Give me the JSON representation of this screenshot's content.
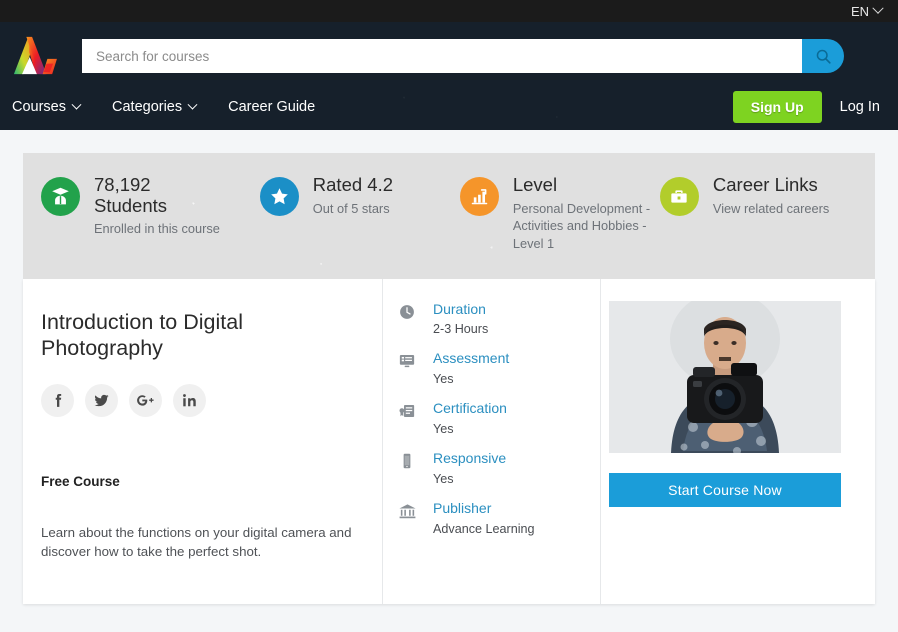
{
  "topbar": {
    "language": "EN",
    "chevron_icon": "chevron-down-icon"
  },
  "header": {
    "logo_icon": "brand-logo-icon",
    "search": {
      "placeholder": "Search for courses",
      "value": "",
      "button_icon": "search-icon"
    },
    "nav": [
      {
        "label": "Courses",
        "has_caret": true
      },
      {
        "label": "Categories",
        "has_caret": true
      },
      {
        "label": "Career Guide",
        "has_caret": false
      }
    ],
    "signup_label": "Sign Up",
    "login_label": "Log In",
    "signup_color": "#7ed321",
    "background_color": "#16202b"
  },
  "stats": [
    {
      "icon": "graduate-student-icon",
      "icon_color": "#22a24b",
      "title": "78,192",
      "title2": "Students",
      "sub": "Enrolled in this course"
    },
    {
      "icon": "star-icon",
      "icon_color": "#1b8fc7",
      "title": "Rated 4.2",
      "title2": "",
      "sub": "Out of 5 stars"
    },
    {
      "icon": "bar-chart-icon",
      "icon_color": "#f5952a",
      "title": "Level",
      "title2": "",
      "sub": "Personal Development - Activities and Hobbies - Level 1"
    },
    {
      "icon": "briefcase-icon",
      "icon_color": "#b2cd2b",
      "title": "Career Links",
      "title2": "",
      "sub": "View related careers"
    }
  ],
  "course": {
    "title": "Introduction to Digital Photography",
    "socials": [
      {
        "name": "facebook-icon",
        "label": "f"
      },
      {
        "name": "twitter-icon",
        "label": "t"
      },
      {
        "name": "google-plus-icon",
        "label": "G+"
      },
      {
        "name": "linkedin-icon",
        "label": "in"
      }
    ],
    "price_label": "Free Course",
    "description": "Learn about the functions on your digital camera and discover how to take the perfect shot."
  },
  "details": [
    {
      "icon": "clock-icon",
      "label": "Duration",
      "value": "2-3 Hours"
    },
    {
      "icon": "assessment-icon",
      "label": "Assessment",
      "value": "Yes"
    },
    {
      "icon": "certificate-icon",
      "label": "Certification",
      "value": "Yes"
    },
    {
      "icon": "mobile-icon",
      "label": "Responsive",
      "value": "Yes"
    },
    {
      "icon": "bank-icon",
      "label": "Publisher",
      "value": "Advance Learning"
    }
  ],
  "promo": {
    "image_alt": "man-holding-camera-photo",
    "cta_label": "Start Course Now",
    "cta_color": "#1b9dd9"
  }
}
